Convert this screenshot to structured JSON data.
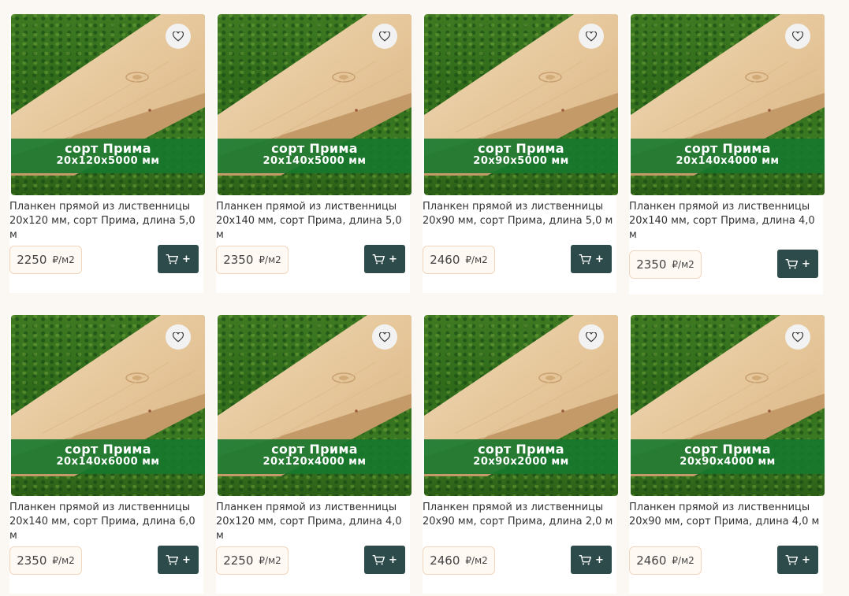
{
  "products": [
    {
      "banner_grade": "сорт Прима",
      "banner_size": "20х120х5000 мм",
      "title": "Планкен прямой из лиственницы 20х120 мм, сорт Прима, длина 5,0 м",
      "price": "2250",
      "unit": "₽/м2",
      "cart_label": "+"
    },
    {
      "banner_grade": "сорт Прима",
      "banner_size": "20х140х5000 мм",
      "title": "Планкен прямой из лиственницы 20х140 мм, сорт Прима, длина 5,0 м",
      "price": "2350",
      "unit": "₽/м2",
      "cart_label": "+"
    },
    {
      "banner_grade": "сорт Прима",
      "banner_size": "20х90х5000 мм",
      "title": "Планкен прямой из лиственницы 20х90 мм, сорт Прима, длина 5,0 м",
      "price": "2460",
      "unit": "₽/м2",
      "cart_label": "+"
    },
    {
      "banner_grade": "сорт Прима",
      "banner_size": "20х140х4000 мм",
      "title": "Планкен прямой из лиственницы 20х140 мм, сорт Прима, длина 4,0 м",
      "price": "2350",
      "unit": "₽/м2",
      "cart_label": "+"
    },
    {
      "banner_grade": "сорт Прима",
      "banner_size": "20х140х6000 мм",
      "title": "Планкен прямой из лиственницы 20х140 мм, сорт Прима, длина 6,0 м",
      "price": "2350",
      "unit": "₽/м2",
      "cart_label": "+"
    },
    {
      "banner_grade": "сорт Прима",
      "banner_size": "20х120х4000 мм",
      "title": "Планкен прямой из лиственницы 20х120 мм, сорт Прима, длина 4,0 м",
      "price": "2250",
      "unit": "₽/м2",
      "cart_label": "+"
    },
    {
      "banner_grade": "сорт Прима",
      "banner_size": "20х90х2000 мм",
      "title": "Планкен прямой из лиственницы 20х90 мм, сорт Прима, длина 2,0 м",
      "price": "2460",
      "unit": "₽/м2",
      "cart_label": "+"
    },
    {
      "banner_grade": "сорт Прима",
      "banner_size": "20х90х4000 мм",
      "title": "Планкен прямой из лиственницы 20х90 мм, сорт Прима, длина 4,0 м",
      "price": "2460",
      "unit": "₽/м2",
      "cart_label": "+"
    }
  ],
  "icons": {
    "favorite": "heart-icon",
    "cart": "cart-icon"
  },
  "colors": {
    "banner_green": "#16782d",
    "cart_button": "#2d4b4b",
    "price_border": "#f2d6bd"
  }
}
